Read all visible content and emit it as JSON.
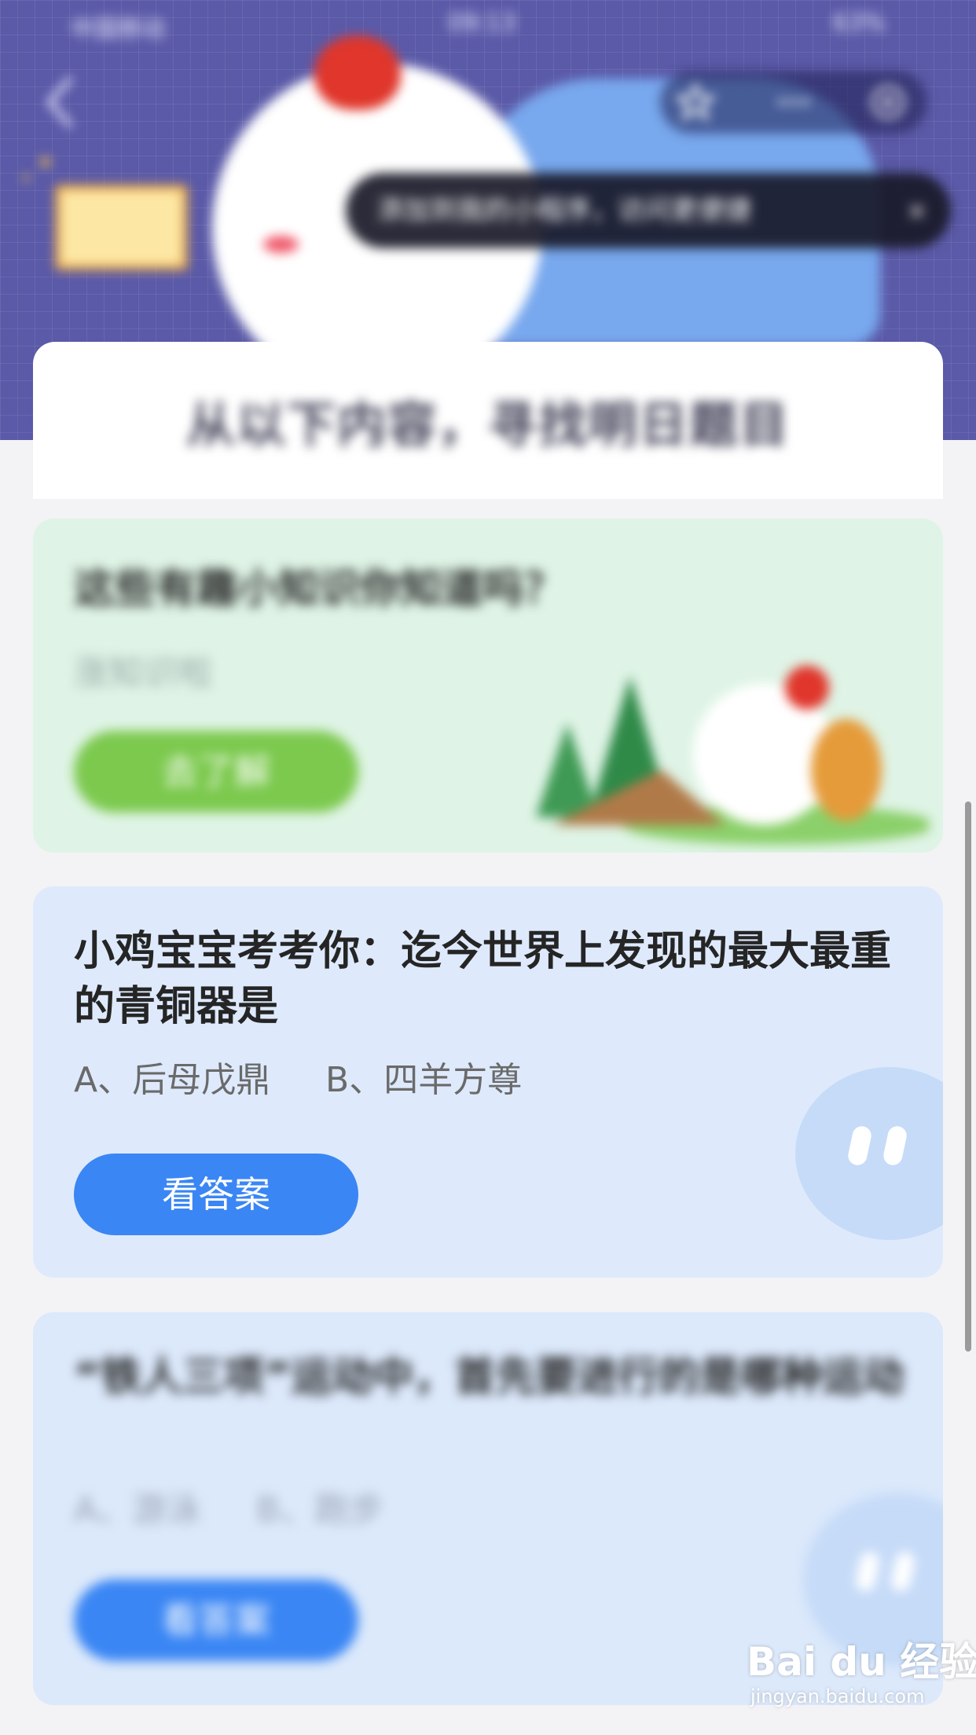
{
  "status_bar": {
    "carrier": "中国移动",
    "time": "09:13",
    "battery": "63%"
  },
  "tooltip": {
    "text": "添加到我的小程序，访问更便捷",
    "close": "×"
  },
  "section_title": "从以下内容，寻找明日题目",
  "cards": [
    {
      "title": "这些有趣小知识你知道吗？",
      "subtitle": "涨知识啦",
      "button": "去了解"
    },
    {
      "title": "小鸡宝宝考考你：迄今世界上发现的最大最重的青铜器是",
      "options": "A、后母戊鼎     B、四羊方尊",
      "button": "看答案"
    },
    {
      "title": "“铁人三项”运动中，首先要进行的是哪种运动",
      "options": "A、游泳     B、跑步",
      "button": "看答案"
    }
  ],
  "watermark": {
    "logo": "Bai du 经验",
    "url": "jingyan.baidu.com"
  },
  "colors": {
    "header_bg": "#5b5aa8",
    "primary_button": "#3a86f4",
    "green_button": "#7cc94e",
    "card_blue": "#deeafc",
    "card_green": "#dff4e6"
  }
}
